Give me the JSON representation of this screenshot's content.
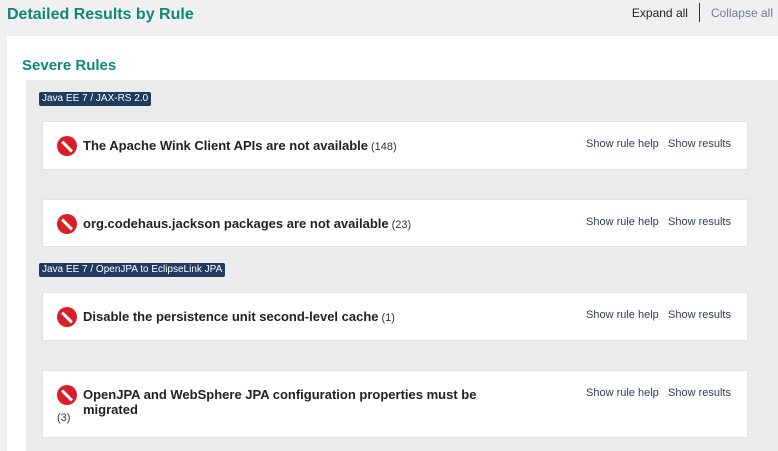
{
  "header": {
    "title": "Detailed Results by Rule",
    "expand_all": "Expand all",
    "collapse_all": "Collapse all"
  },
  "section": {
    "title": "Severe Rules"
  },
  "groups": [
    {
      "label": "Java EE 7 / JAX-RS 2.0",
      "rules": [
        {
          "title": "The Apache Wink Client APIs are not available",
          "count": "(148)",
          "help": "Show rule help",
          "results": "Show results"
        },
        {
          "title": "org.codehaus.jackson packages are not available",
          "count": "(23)",
          "help": "Show rule help",
          "results": "Show results"
        }
      ]
    },
    {
      "label": "Java EE 7 / OpenJPA to EclipseLink JPA",
      "rules": [
        {
          "title": "Disable the persistence unit second-level cache",
          "count": "(1)",
          "help": "Show rule help",
          "results": "Show results"
        },
        {
          "title": "OpenJPA and WebSphere JPA configuration properties must be migrated",
          "count": "(3)",
          "help": "Show rule help",
          "results": "Show results"
        }
      ]
    }
  ],
  "colors": {
    "accent_green": "#0e8a73",
    "tag_navy": "#1f3b60",
    "severe_red": "#da1e28"
  },
  "icons": {
    "severity": "severe-error-icon"
  }
}
